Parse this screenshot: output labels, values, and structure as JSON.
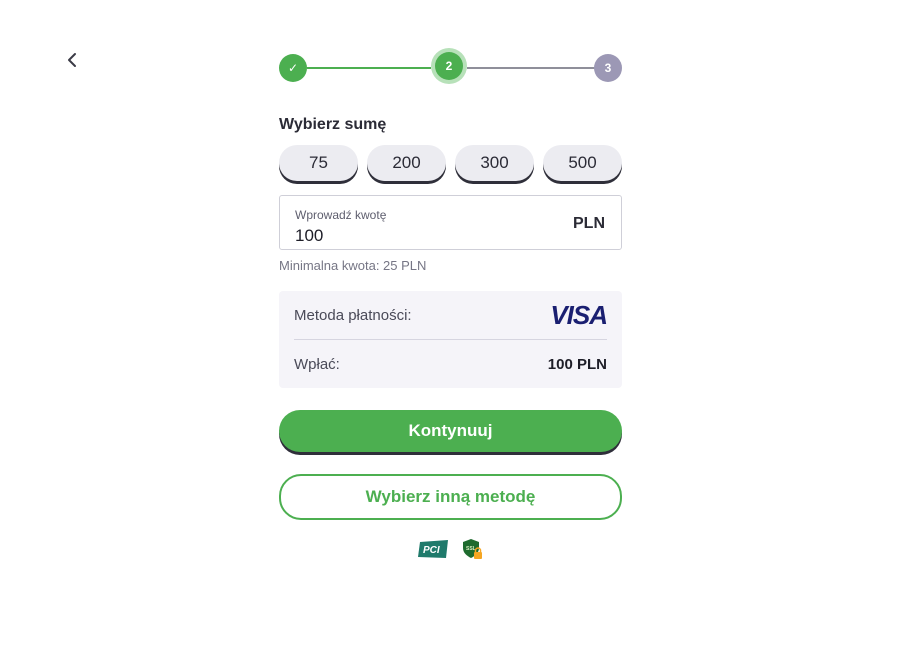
{
  "nav": {
    "back_icon": "chevron-left-icon"
  },
  "stepper": {
    "steps": [
      {
        "label": "✓",
        "state": "done"
      },
      {
        "label": "2",
        "state": "active"
      },
      {
        "label": "3",
        "state": "pending"
      }
    ]
  },
  "amount_section": {
    "title": "Wybierz sumę",
    "presets": [
      "75",
      "200",
      "300",
      "500"
    ]
  },
  "amount_input": {
    "label": "Wprowadź kwotę",
    "value": "100",
    "currency": "PLN",
    "min_note": "Minimalna kwota: 25 PLN"
  },
  "summary": {
    "method_label": "Metoda płatności:",
    "method_brand": "VISA",
    "deposit_label": "Wpłać:",
    "deposit_value": "100 PLN"
  },
  "actions": {
    "continue_label": "Kontynuuj",
    "other_method_label": "Wybierz inną metodę"
  },
  "badges": {
    "pci_text": "PCI",
    "ssl_text": "SSL"
  },
  "colors": {
    "accent": "#4caf50",
    "visa": "#1a1f71",
    "pending_step": "#9c98b5"
  }
}
